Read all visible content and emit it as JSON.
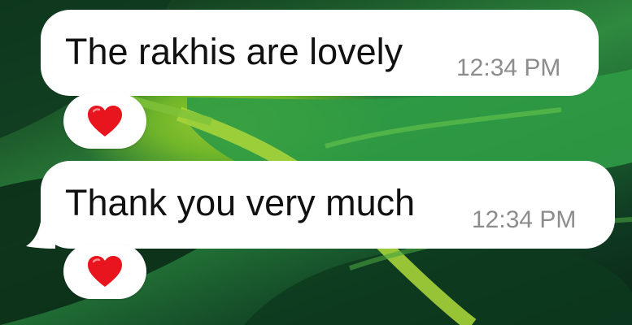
{
  "chat": {
    "messages": [
      {
        "text": "The rakhis are lovely",
        "time": "12:34 PM",
        "reaction": "heart-emoji"
      },
      {
        "text": "Thank you very much",
        "time": "12:34 PM",
        "reaction": "heart-emoji"
      }
    ]
  },
  "colors": {
    "bubble": "#ffffff",
    "text": "#111111",
    "time": "#8c8c8c",
    "heart": "#e8141e"
  }
}
